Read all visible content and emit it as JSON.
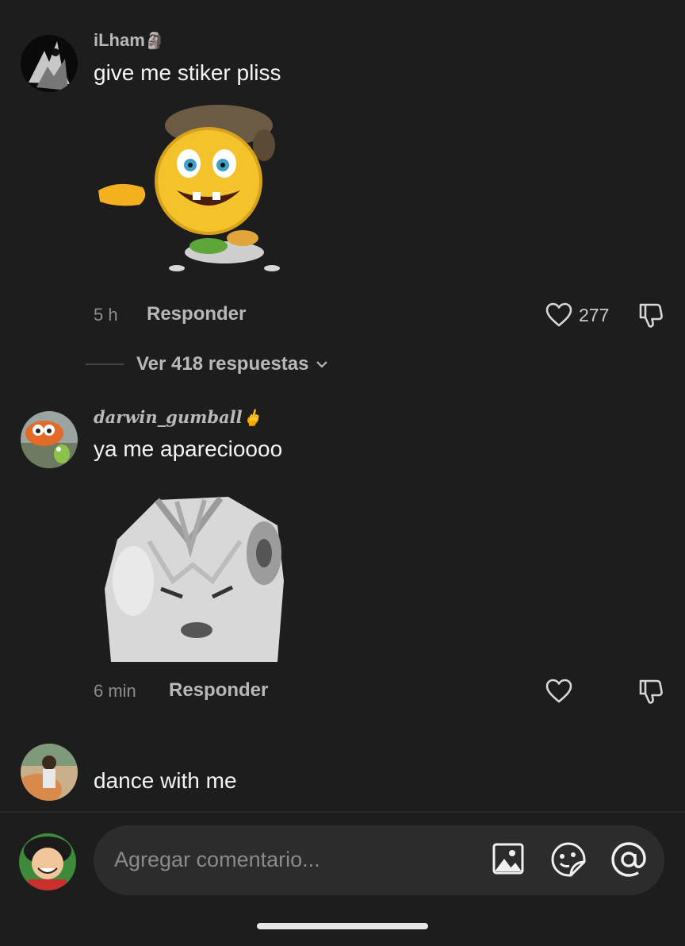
{
  "comments": [
    {
      "username": "iLham",
      "username_emoji": "🗿",
      "text": "give me stiker pliss",
      "sticker": "smiley-eating-sticker",
      "time": "5 h",
      "reply_label": "Responder",
      "likes": "277",
      "view_replies": "Ver 418 respuestas"
    },
    {
      "username": "darwin_gumball",
      "username_emoji": "🖕",
      "text": "ya me aparecioooo",
      "sticker": "white-cat-sticker",
      "time": "6 min",
      "reply_label": "Responder"
    },
    {
      "text": "dance with me"
    }
  ],
  "composer": {
    "placeholder": "Agregar comentario...",
    "icons": [
      "image-icon",
      "sticker-icon",
      "mention-icon"
    ]
  },
  "colors": {
    "background": "#1d1d1d",
    "input_bg": "#2c2c2c",
    "muted_text": "#8d8d8d"
  }
}
